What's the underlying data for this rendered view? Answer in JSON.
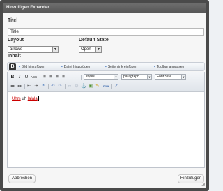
{
  "dialog": {
    "title": "Hinzufügen Expander"
  },
  "form": {
    "titel_label": "Titel",
    "titel_value": "Title",
    "layout_label": "Layout",
    "layout_value": "arrows",
    "default_state_label": "Default State",
    "default_state_value": "Open",
    "inhalt_label": "Inhalt"
  },
  "media_tabs": {
    "logo": "B",
    "items": [
      "Bild hinzufügen",
      "Datei hinzufügen",
      "Seitenlink einfügen",
      "Toolbar anpassen"
    ]
  },
  "toolbar": {
    "styles_value": "styles",
    "paragraph_value": "paragraph",
    "fontsize_value": "Font Size",
    "bold": "B",
    "italic": "I",
    "underline": "U",
    "strike": "ABC"
  },
  "editor": {
    "word1": "Uhm",
    "word2": "uh",
    "word3": "lalala"
  },
  "buttons": {
    "cancel": "Abbrechen",
    "add": "Hinzufügen"
  },
  "colors": {
    "frame": "#4a4a4a",
    "titlebar": "#5f5f5f",
    "misspelled": "#cc0000"
  }
}
